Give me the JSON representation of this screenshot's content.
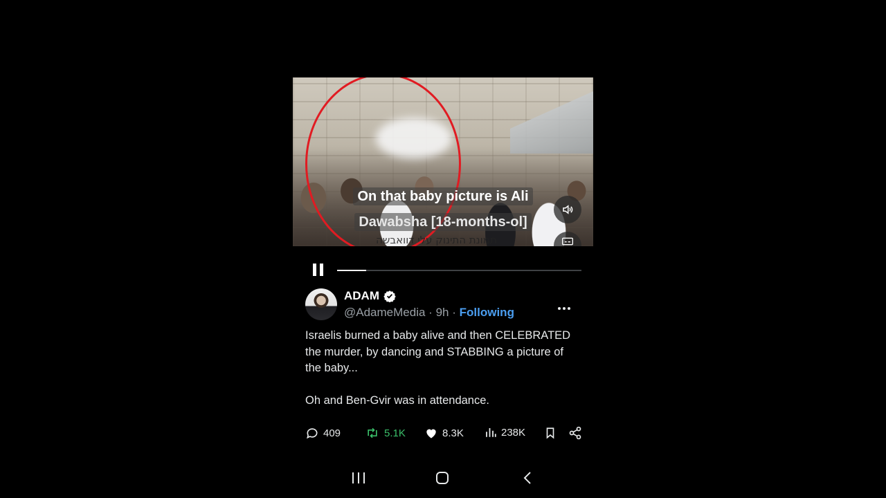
{
  "video": {
    "caption_line1": "On that baby picture is Ali",
    "caption_line2": "Dawabsha [18-months-ol]",
    "overlay_hebrew": "תמונת התינוק עלי דוואבשה",
    "progress_fraction": 0.12,
    "volume_icon": "speaker-icon",
    "captions_icon": "captions-icon"
  },
  "author": {
    "name": "ADAM",
    "handle": "@AdameMedia",
    "separator": "·",
    "time": "9h",
    "follow_state": "Following",
    "verified": true
  },
  "tweet": {
    "paragraph1": "Israelis burned a baby alive and then CELEBRATED the murder, by dancing and STABBING a picture of the baby...",
    "paragraph2": "Oh and Ben-Gvir was in attendance."
  },
  "actions": {
    "replies": "409",
    "retweets": "5.1K",
    "likes": "8.3K",
    "views": "238K"
  },
  "colors": {
    "background": "#000000",
    "accent_blue": "#4b9ef0",
    "retweet_green": "#3bbf6a",
    "highlight_red": "#e11b22"
  }
}
